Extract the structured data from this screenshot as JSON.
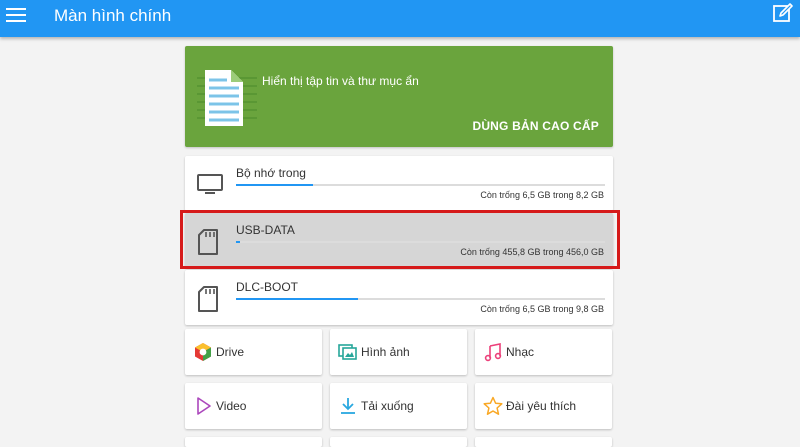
{
  "appbar": {
    "title": "Màn hình chính"
  },
  "promo": {
    "text": "Hiển thị tập tin và thư mục ẩn",
    "button": "DÙNG BẢN CAO CẤP"
  },
  "storage": [
    {
      "name": "Bộ nhớ trong",
      "free": "Còn trống 6,5 GB trong 8,2 GB",
      "used_fraction": 0.21,
      "icon": "tv-icon"
    },
    {
      "name": "USB-DATA",
      "free": "Còn trống 455,8 GB trong 456,0 GB",
      "used_fraction": 0.01,
      "icon": "sd-card-icon",
      "selected": true
    },
    {
      "name": "DLC-BOOT",
      "free": "Còn trống 6,5 GB trong 9,8 GB",
      "used_fraction": 0.33,
      "icon": "sd-card-icon"
    }
  ],
  "tiles": [
    {
      "label": "Drive",
      "icon": "drive-icon"
    },
    {
      "label": "Hình ảnh",
      "icon": "images-icon"
    },
    {
      "label": "Nhạc",
      "icon": "music-icon"
    },
    {
      "label": "Video",
      "icon": "video-icon"
    },
    {
      "label": "Tải xuống",
      "icon": "download-icon"
    },
    {
      "label": "Đài yêu thích",
      "icon": "star-icon"
    }
  ],
  "colors": {
    "appbar": "#2196f3",
    "promo": "#6aa43d",
    "highlight": "#d61a1a",
    "progress": "#2196f3"
  }
}
